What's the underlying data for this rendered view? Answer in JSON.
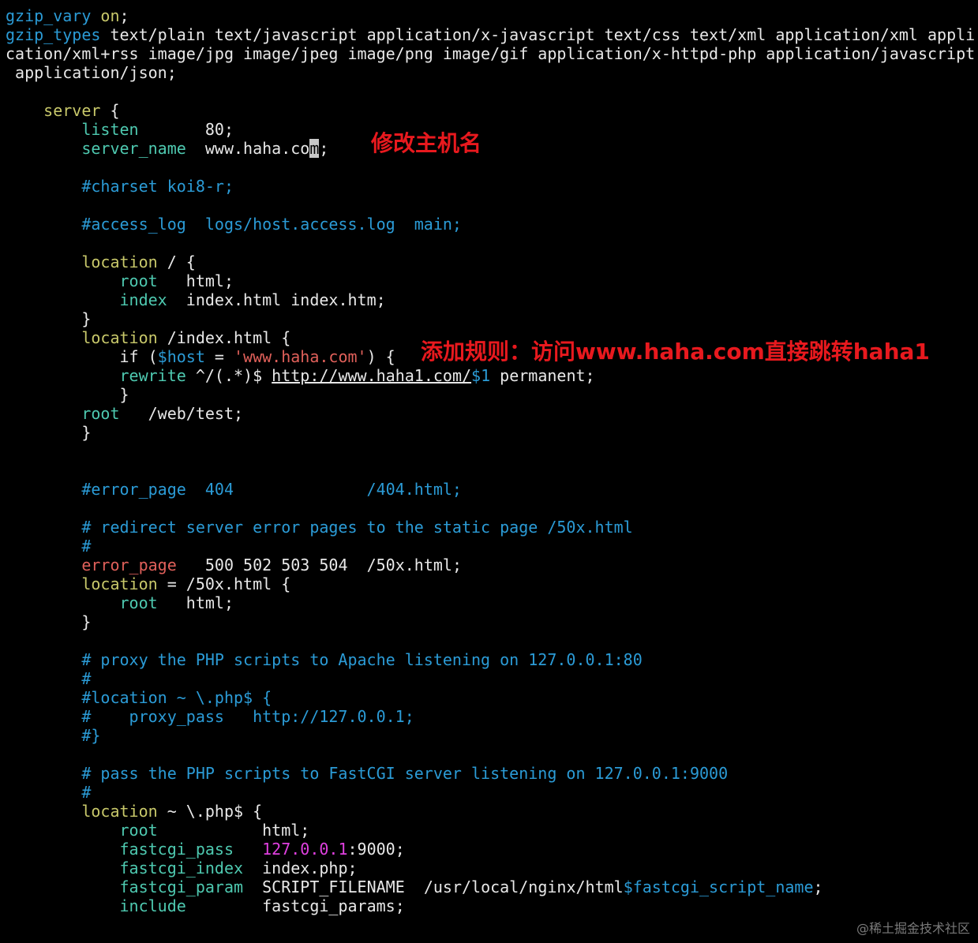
{
  "colors": {
    "default": "#e8e8e8",
    "directive": "#c8c86a",
    "green": "#4ec9b0",
    "comment": "#2b9bd6",
    "red_keyword": "#e0605a",
    "string": "#e0605a",
    "magenta": "#e040e0",
    "annotation": "#e8191e"
  },
  "editor": {
    "lines": [
      [
        [
          "gzip_vary",
          "comment"
        ],
        [
          " ",
          "default"
        ],
        [
          "on",
          "directive"
        ],
        [
          ";",
          "default"
        ]
      ],
      [
        [
          "gzip_types",
          "comment"
        ],
        [
          " text/plain text/javascript application/x-javascript text/css text/xml application/xml appli",
          "default"
        ]
      ],
      [
        [
          "cation/xml+rss image/jpg image/jpeg image/png image/gif application/x-httpd-php application/javascript",
          "default"
        ]
      ],
      [
        [
          " application/json;",
          "default"
        ]
      ],
      [],
      [
        [
          "    ",
          "default"
        ],
        [
          "server",
          "directive"
        ],
        [
          " {",
          "default"
        ]
      ],
      [
        [
          "        ",
          "default"
        ],
        [
          "listen",
          "green"
        ],
        [
          "       80;",
          "default"
        ]
      ],
      [
        [
          "        ",
          "default"
        ],
        [
          "server_name",
          "green"
        ],
        [
          "  www.haha.co",
          "default"
        ],
        [
          "m",
          "cursor"
        ],
        [
          ";",
          "default"
        ]
      ],
      [],
      [
        [
          "        ",
          "default"
        ],
        [
          "#charset koi8-r;",
          "comment"
        ]
      ],
      [],
      [
        [
          "        ",
          "default"
        ],
        [
          "#access_log  logs/host.access.log  main;",
          "comment"
        ]
      ],
      [],
      [
        [
          "        ",
          "default"
        ],
        [
          "location",
          "directive"
        ],
        [
          " / {",
          "default"
        ]
      ],
      [
        [
          "            ",
          "default"
        ],
        [
          "root",
          "green"
        ],
        [
          "   html;",
          "default"
        ]
      ],
      [
        [
          "            ",
          "default"
        ],
        [
          "index",
          "green"
        ],
        [
          "  index.html index.htm;",
          "default"
        ]
      ],
      [
        [
          "        }",
          "default"
        ]
      ],
      [
        [
          "        ",
          "default"
        ],
        [
          "location",
          "directive"
        ],
        [
          " /index.html {",
          "default"
        ]
      ],
      [
        [
          "            if (",
          "default"
        ],
        [
          "$host",
          "comment"
        ],
        [
          " = ",
          "default"
        ],
        [
          "'www.haha.com'",
          "string"
        ],
        [
          ") {",
          "default"
        ]
      ],
      [
        [
          "            ",
          "default"
        ],
        [
          "rewrite",
          "green"
        ],
        [
          " ^/(.*)$ ",
          "default"
        ],
        [
          "http://www.haha1.com/",
          "default",
          "u"
        ],
        [
          "$1",
          "comment"
        ],
        [
          " permanent;",
          "default"
        ]
      ],
      [
        [
          "            }",
          "default"
        ]
      ],
      [
        [
          "        ",
          "default"
        ],
        [
          "root",
          "green"
        ],
        [
          "   /web/test;",
          "default"
        ]
      ],
      [
        [
          "        }",
          "default"
        ]
      ],
      [],
      [],
      [
        [
          "        ",
          "default"
        ],
        [
          "#error_page  404              /404.html;",
          "comment"
        ]
      ],
      [],
      [
        [
          "        ",
          "default"
        ],
        [
          "# redirect server error pages to the static page /50x.html",
          "comment"
        ]
      ],
      [
        [
          "        ",
          "default"
        ],
        [
          "#",
          "comment"
        ]
      ],
      [
        [
          "        ",
          "default"
        ],
        [
          "error_page",
          "red_keyword"
        ],
        [
          "   500 502 503 504  /50x.html;",
          "default"
        ]
      ],
      [
        [
          "        ",
          "default"
        ],
        [
          "location",
          "directive"
        ],
        [
          " = /50x.html {",
          "default"
        ]
      ],
      [
        [
          "            ",
          "default"
        ],
        [
          "root",
          "green"
        ],
        [
          "   html;",
          "default"
        ]
      ],
      [
        [
          "        }",
          "default"
        ]
      ],
      [],
      [
        [
          "        ",
          "default"
        ],
        [
          "# proxy the PHP scripts to Apache listening on 127.0.0.1:80",
          "comment"
        ]
      ],
      [
        [
          "        ",
          "default"
        ],
        [
          "#",
          "comment"
        ]
      ],
      [
        [
          "        ",
          "default"
        ],
        [
          "#location ~ \\.php$ {",
          "comment"
        ]
      ],
      [
        [
          "        ",
          "default"
        ],
        [
          "#    proxy_pass   http://127.0.0.1;",
          "comment"
        ]
      ],
      [
        [
          "        ",
          "default"
        ],
        [
          "#}",
          "comment"
        ]
      ],
      [],
      [
        [
          "        ",
          "default"
        ],
        [
          "# pass the PHP scripts to FastCGI server listening on 127.0.0.1:9000",
          "comment"
        ]
      ],
      [
        [
          "        ",
          "default"
        ],
        [
          "#",
          "comment"
        ]
      ],
      [
        [
          "        ",
          "default"
        ],
        [
          "location",
          "directive"
        ],
        [
          " ~ \\.php$ {",
          "default"
        ]
      ],
      [
        [
          "            ",
          "default"
        ],
        [
          "root",
          "green"
        ],
        [
          "           html;",
          "default"
        ]
      ],
      [
        [
          "            ",
          "default"
        ],
        [
          "fastcgi_pass",
          "green"
        ],
        [
          "   ",
          "default"
        ],
        [
          "127.0.0.1",
          "magenta"
        ],
        [
          ":9000;",
          "default"
        ]
      ],
      [
        [
          "            ",
          "default"
        ],
        [
          "fastcgi_index",
          "green"
        ],
        [
          "  index.php;",
          "default"
        ]
      ],
      [
        [
          "            ",
          "default"
        ],
        [
          "fastcgi_param",
          "green"
        ],
        [
          "  SCRIPT_FILENAME  /usr/local/nginx/html",
          "default"
        ],
        [
          "$fastcgi_script_name",
          "comment"
        ],
        [
          ";",
          "default"
        ]
      ],
      [
        [
          "            ",
          "default"
        ],
        [
          "include",
          "green"
        ],
        [
          "        fastcgi_params;",
          "default"
        ]
      ]
    ]
  },
  "annotations": {
    "hostname": "修改主机名",
    "rule": "添加规则：访问www.haha.com直接跳转haha1"
  },
  "watermark": "@稀土掘金技术社区"
}
